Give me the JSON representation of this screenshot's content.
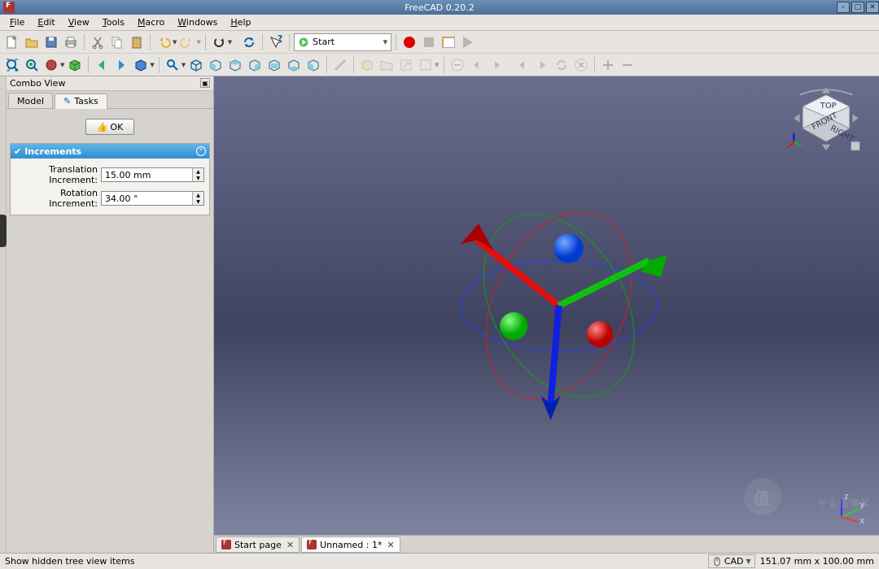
{
  "window": {
    "title": "FreeCAD 0.20.2"
  },
  "menubar": [
    "File",
    "Edit",
    "View",
    "Tools",
    "Macro",
    "Windows",
    "Help"
  ],
  "workbench": {
    "selected": "Start"
  },
  "combo": {
    "title": "Combo View",
    "tabs": {
      "model": "Model",
      "tasks": "Tasks"
    },
    "ok_label": "OK",
    "increments": {
      "header": "Increments",
      "translation_label": "Translation Increment:",
      "translation_value": "15.00 mm",
      "rotation_label": "Rotation Increment:",
      "rotation_value": "34.00 °"
    }
  },
  "doc_tabs": [
    {
      "label": "Start page",
      "active": false
    },
    {
      "label": "Unnamed : 1*",
      "active": true
    }
  ],
  "statusbar": {
    "hint": "Show hidden tree view items",
    "cad": "CAD",
    "dims": "151.07 mm x 100.00 mm"
  },
  "navcube": {
    "front": "FRONT",
    "right": "RIGHT",
    "top": "TOP"
  },
  "axes": {
    "x": "x",
    "y": "y",
    "z": "z"
  },
  "watermark": "什么值得买"
}
